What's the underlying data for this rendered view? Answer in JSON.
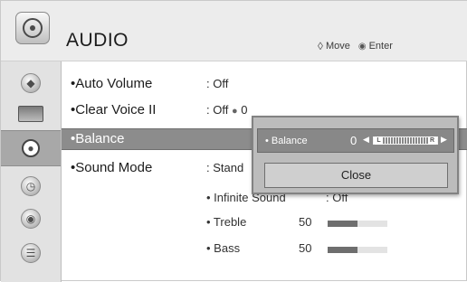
{
  "header": {
    "title": "AUDIO",
    "move_label": "Move",
    "enter_label": "Enter"
  },
  "sidebar": {
    "items": [
      {
        "icon": "picture-icon"
      },
      {
        "icon": "tv-icon"
      },
      {
        "icon": "audio-icon",
        "active": true
      },
      {
        "icon": "clock-icon"
      },
      {
        "icon": "lock-icon"
      },
      {
        "icon": "option-icon"
      }
    ]
  },
  "menu": {
    "auto_volume": {
      "label": "•Auto Volume",
      "value": ": Off"
    },
    "clear_voice": {
      "label": "•Clear Voice II",
      "value": ": Off",
      "level": "0"
    },
    "balance": {
      "label": "•Balance"
    },
    "sound_mode": {
      "label": "•Sound Mode",
      "value": ": Stand"
    },
    "infinite_sound": {
      "label": "• Infinite Sound",
      "value": ": Off"
    },
    "treble": {
      "label": "• Treble",
      "value": "50",
      "level": 0.5
    },
    "bass": {
      "label": "• Bass",
      "value": "50",
      "level": 0.5
    }
  },
  "popup": {
    "balance_label": "• Balance",
    "balance_value": "0",
    "left_marker": "L",
    "right_marker": "R",
    "close_label": "Close"
  }
}
